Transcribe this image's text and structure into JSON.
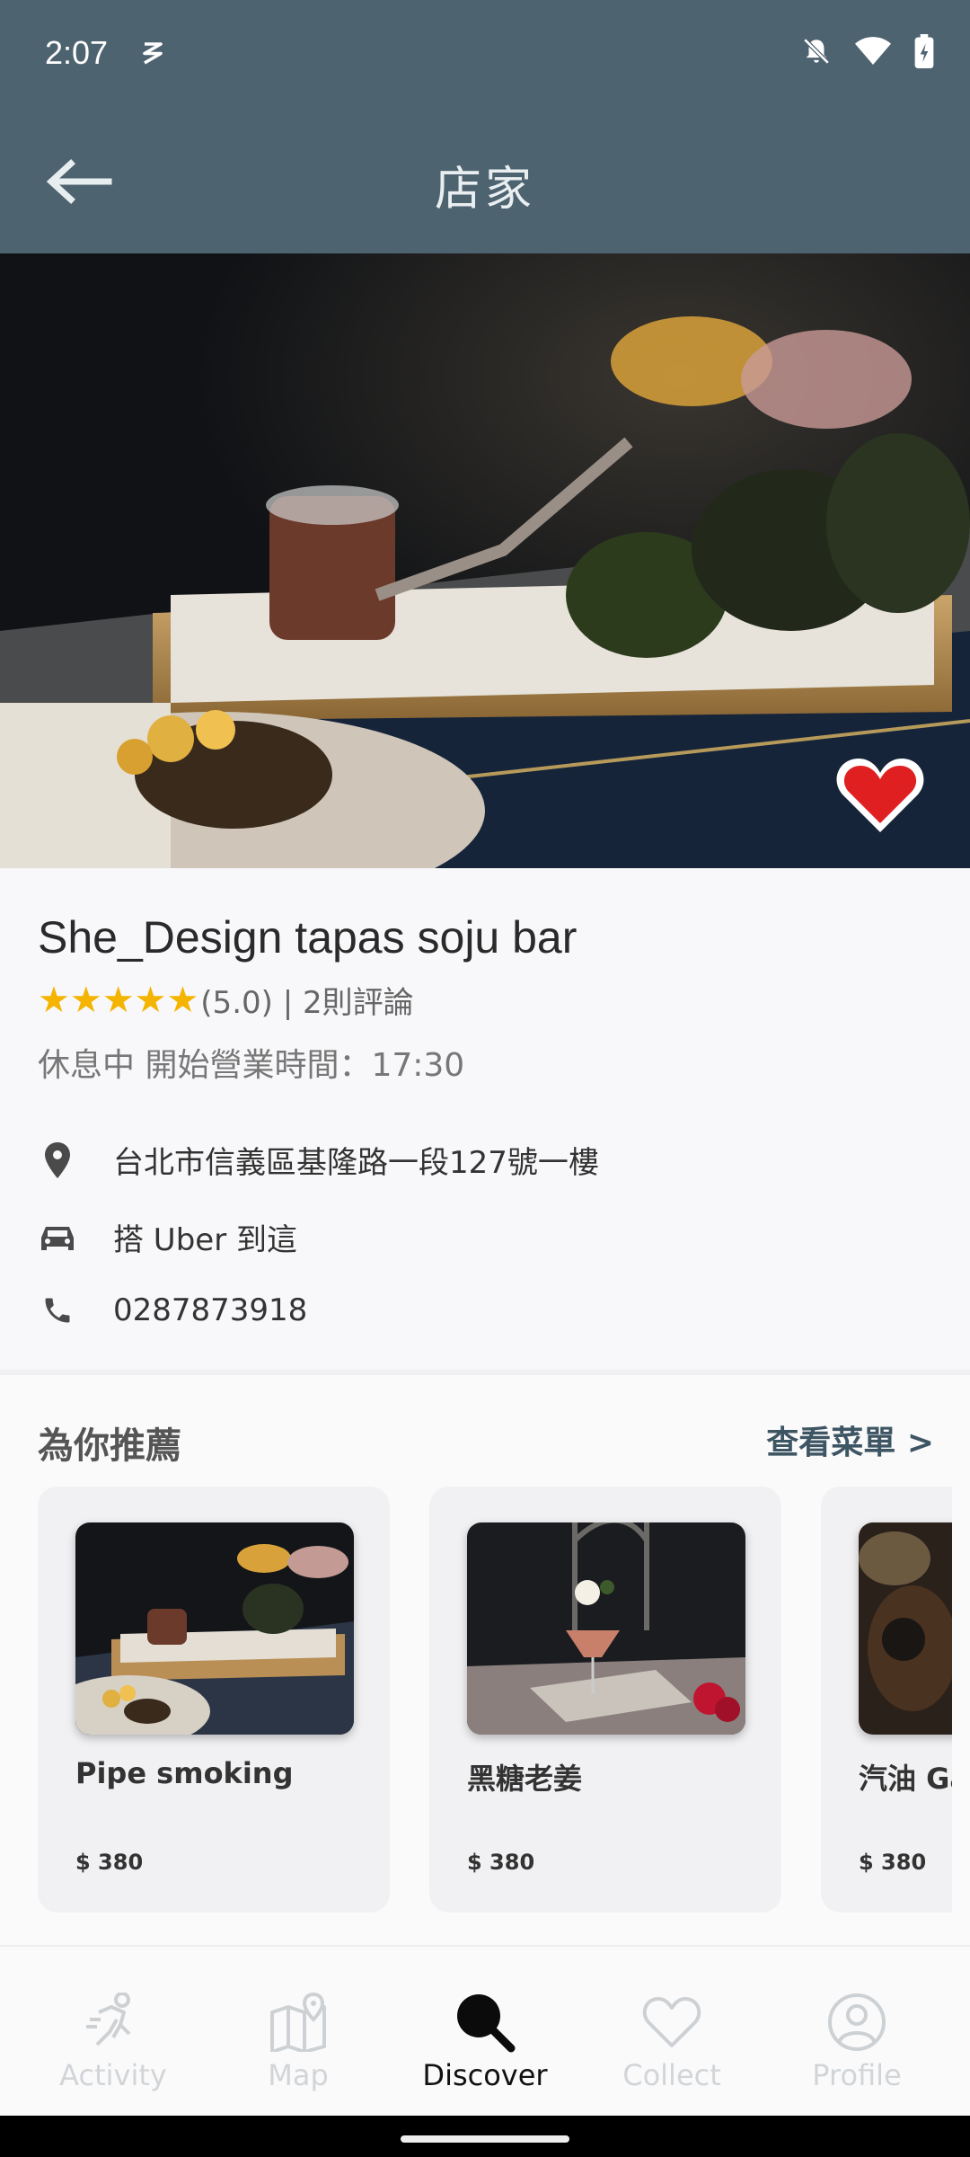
{
  "status_bar": {
    "time": "2:07"
  },
  "app_bar": {
    "title": "店家"
  },
  "shop": {
    "name": "She_Design tapas soju bar",
    "stars": "★★★★★",
    "rating_text": "(5.0) | 2則評論",
    "status": "休息中 開始營業時間：17:30",
    "address": "台北市信義區基隆路一段127號一樓",
    "uber": "搭 Uber 到這",
    "phone": "0287873918"
  },
  "recommend": {
    "title": "為你推薦",
    "menu_link": "查看菜單 >",
    "items": [
      {
        "name": "Pipe smoking",
        "price": "$ 380"
      },
      {
        "name": "黑糖老姜",
        "price": "$ 380"
      },
      {
        "name": "汽油 Gasoline",
        "price": "$ 380"
      }
    ]
  },
  "nav": {
    "items": [
      {
        "label": "Activity",
        "icon": "activity-icon"
      },
      {
        "label": "Map",
        "icon": "map-icon"
      },
      {
        "label": "Discover",
        "icon": "discover-icon",
        "active": true
      },
      {
        "label": "Collect",
        "icon": "heart-icon"
      },
      {
        "label": "Profile",
        "icon": "profile-icon"
      }
    ]
  },
  "colors": {
    "app_bar": "#4e6370",
    "star": "#f4b400",
    "heart": "#e02020",
    "link": "#3e5563"
  }
}
